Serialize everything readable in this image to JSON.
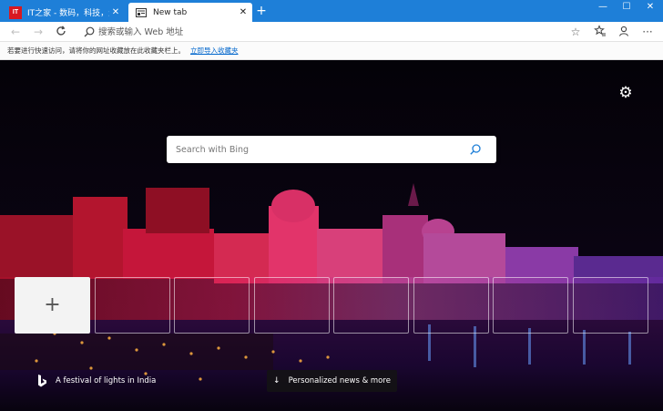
{
  "tabs": [
    {
      "title": "IT之家 - 数码，科技，生活 - 软件",
      "favicon_text": "IT"
    },
    {
      "title": "New tab"
    }
  ],
  "window_controls": {
    "minimize": "—",
    "maximize": "☐",
    "close": "✕"
  },
  "address_bar": {
    "placeholder": "搜索或输入 Web 地址"
  },
  "favorites_bar": {
    "text": "若要进行快速访问，请将你的网址收藏放在此收藏夹栏上。",
    "link": "立即导入收藏夹"
  },
  "search": {
    "placeholder": "Search with Bing"
  },
  "background": {
    "caption": "A festival of lights in India"
  },
  "news_button": {
    "label": "Personalized news & more"
  },
  "quick_links": {
    "add_label": "+"
  },
  "colors": {
    "titlebar": "#1e7fd8",
    "link": "#0066cc",
    "accent": "#1e7fd8"
  }
}
